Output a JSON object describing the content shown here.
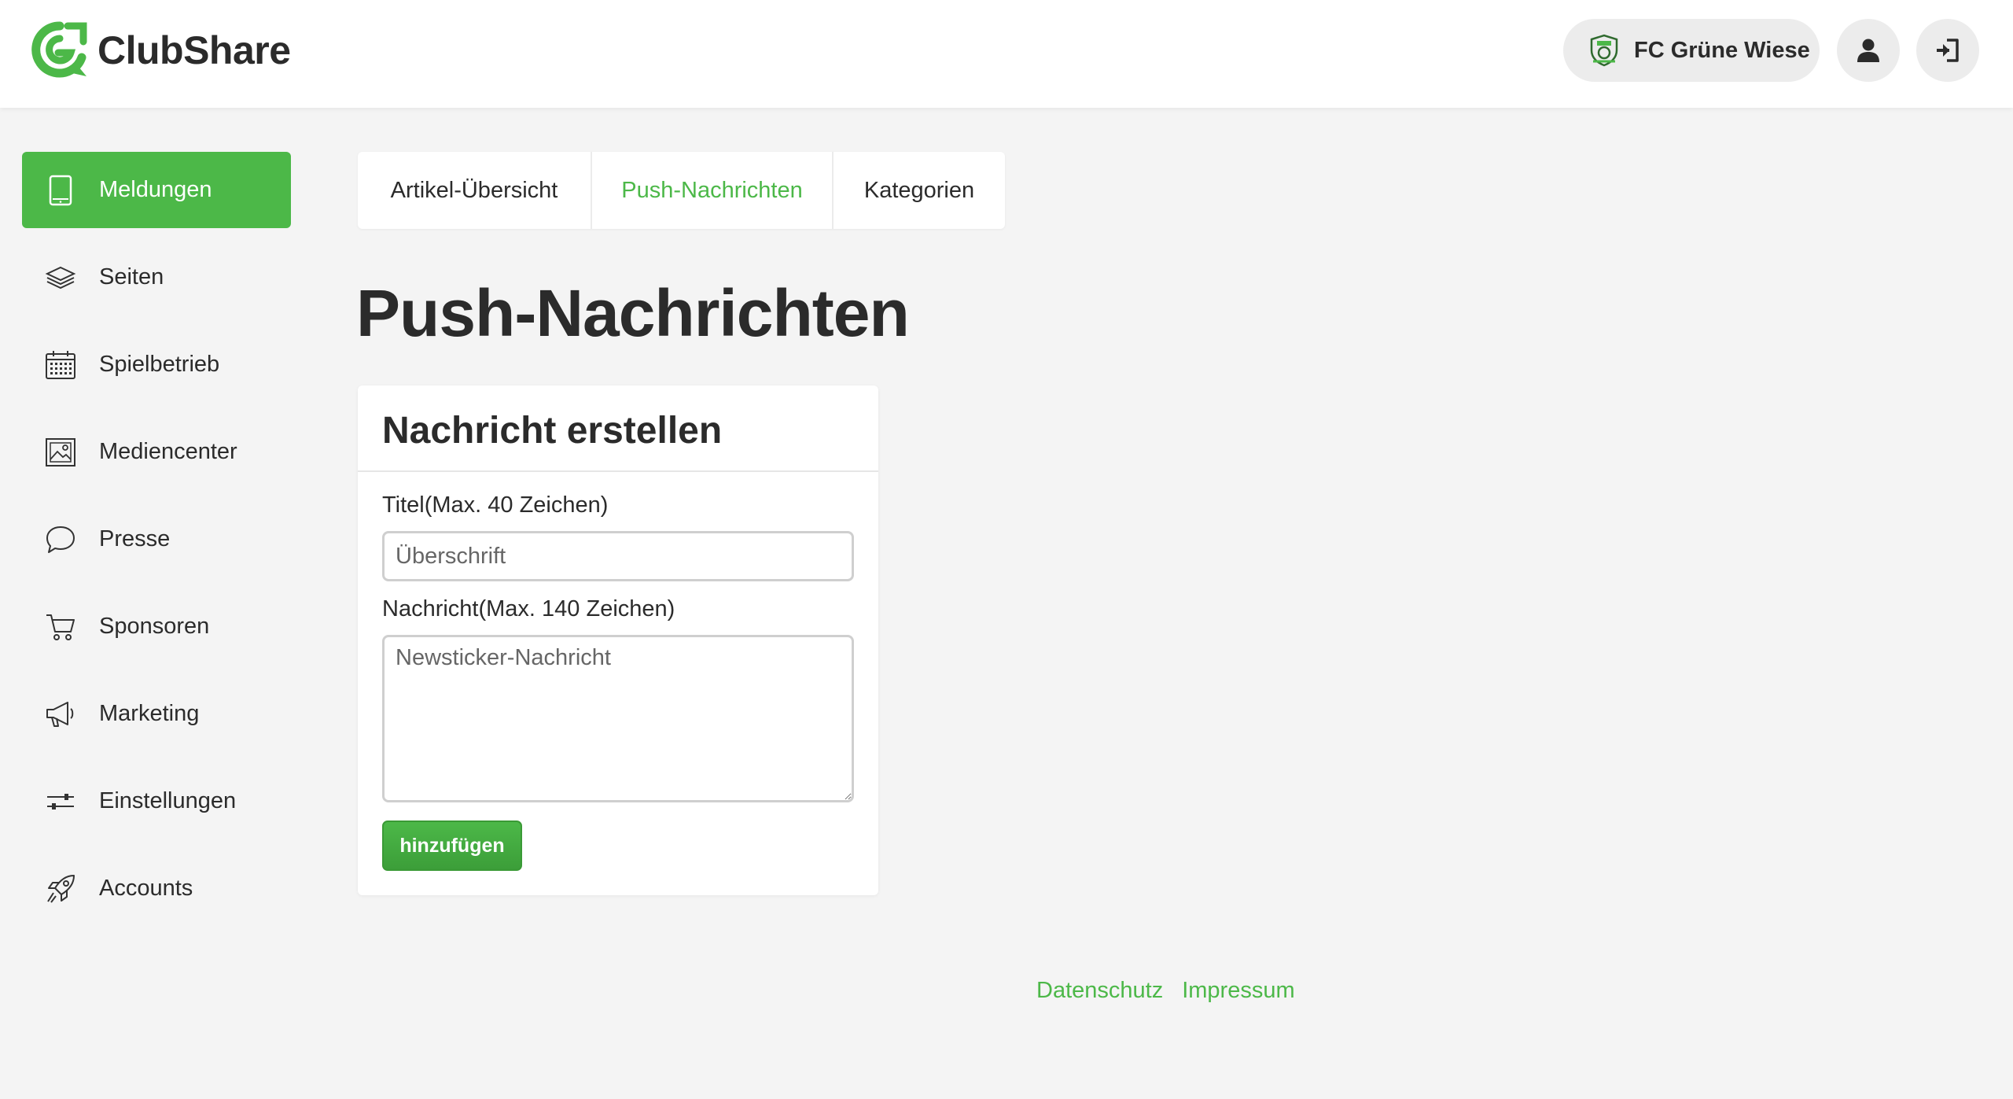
{
  "app": {
    "name": "ClubShare",
    "brand_color": "#4cb848"
  },
  "header": {
    "club_name": "FC Grüne Wiese",
    "icons": [
      "club-crest-icon",
      "user-icon",
      "logout-icon"
    ]
  },
  "sidebar": {
    "items": [
      {
        "label": "Meldungen",
        "icon": "tablet-icon",
        "active": true
      },
      {
        "label": "Seiten",
        "icon": "layers-icon",
        "active": false
      },
      {
        "label": "Spielbetrieb",
        "icon": "calendar-icon",
        "active": false
      },
      {
        "label": "Mediencenter",
        "icon": "image-icon",
        "active": false
      },
      {
        "label": "Presse",
        "icon": "speech-bubble-icon",
        "active": false
      },
      {
        "label": "Sponsoren",
        "icon": "cart-icon",
        "active": false
      },
      {
        "label": "Marketing",
        "icon": "megaphone-icon",
        "active": false
      },
      {
        "label": "Einstellungen",
        "icon": "sliders-icon",
        "active": false
      },
      {
        "label": "Accounts",
        "icon": "rocket-icon",
        "active": false
      }
    ]
  },
  "tabs": [
    {
      "label": "Artikel-Übersicht",
      "active": false
    },
    {
      "label": "Push-Nachrichten",
      "active": true
    },
    {
      "label": "Kategorien",
      "active": false
    }
  ],
  "page": {
    "title": "Push-Nachrichten"
  },
  "form": {
    "card_title": "Nachricht erstellen",
    "title_label": "Titel(Max. 40 Zeichen)",
    "title_value": "",
    "title_placeholder": "Überschrift",
    "message_label": "Nachricht(Max. 140 Zeichen)",
    "message_value": "",
    "message_placeholder": "Newsticker-Nachricht",
    "submit_label": "hinzufügen"
  },
  "footer": {
    "privacy_label": "Datenschutz",
    "imprint_label": "Impressum"
  }
}
